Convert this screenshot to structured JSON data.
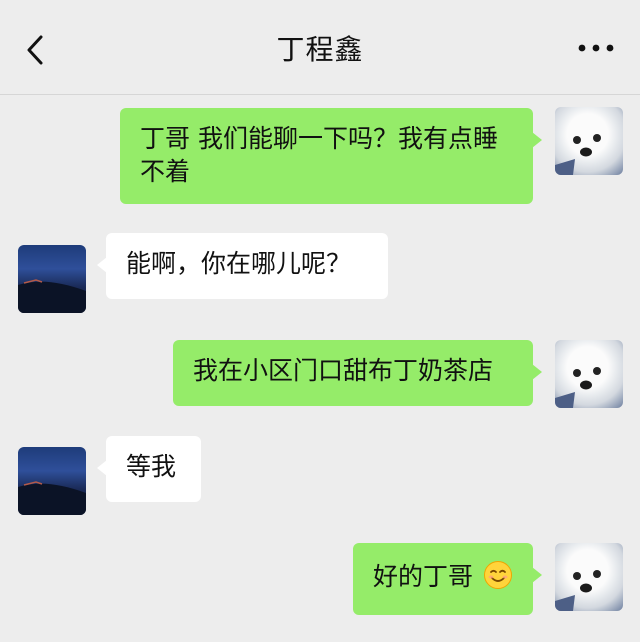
{
  "header": {
    "title": "丁程鑫"
  },
  "messages": [
    {
      "side": "right",
      "text": "丁哥 我们能聊一下吗？我有点睡不着"
    },
    {
      "side": "left",
      "text": "能啊，你在哪儿呢？"
    },
    {
      "side": "right",
      "text": "我在小区门口甜布丁奶茶店"
    },
    {
      "side": "left",
      "text": "等我"
    },
    {
      "side": "right",
      "text": "好的丁哥",
      "emoji": "smiling-face-emoji"
    }
  ],
  "colors": {
    "background": "#ededed",
    "self_bubble": "#95ec69",
    "other_bubble": "#ffffff"
  }
}
